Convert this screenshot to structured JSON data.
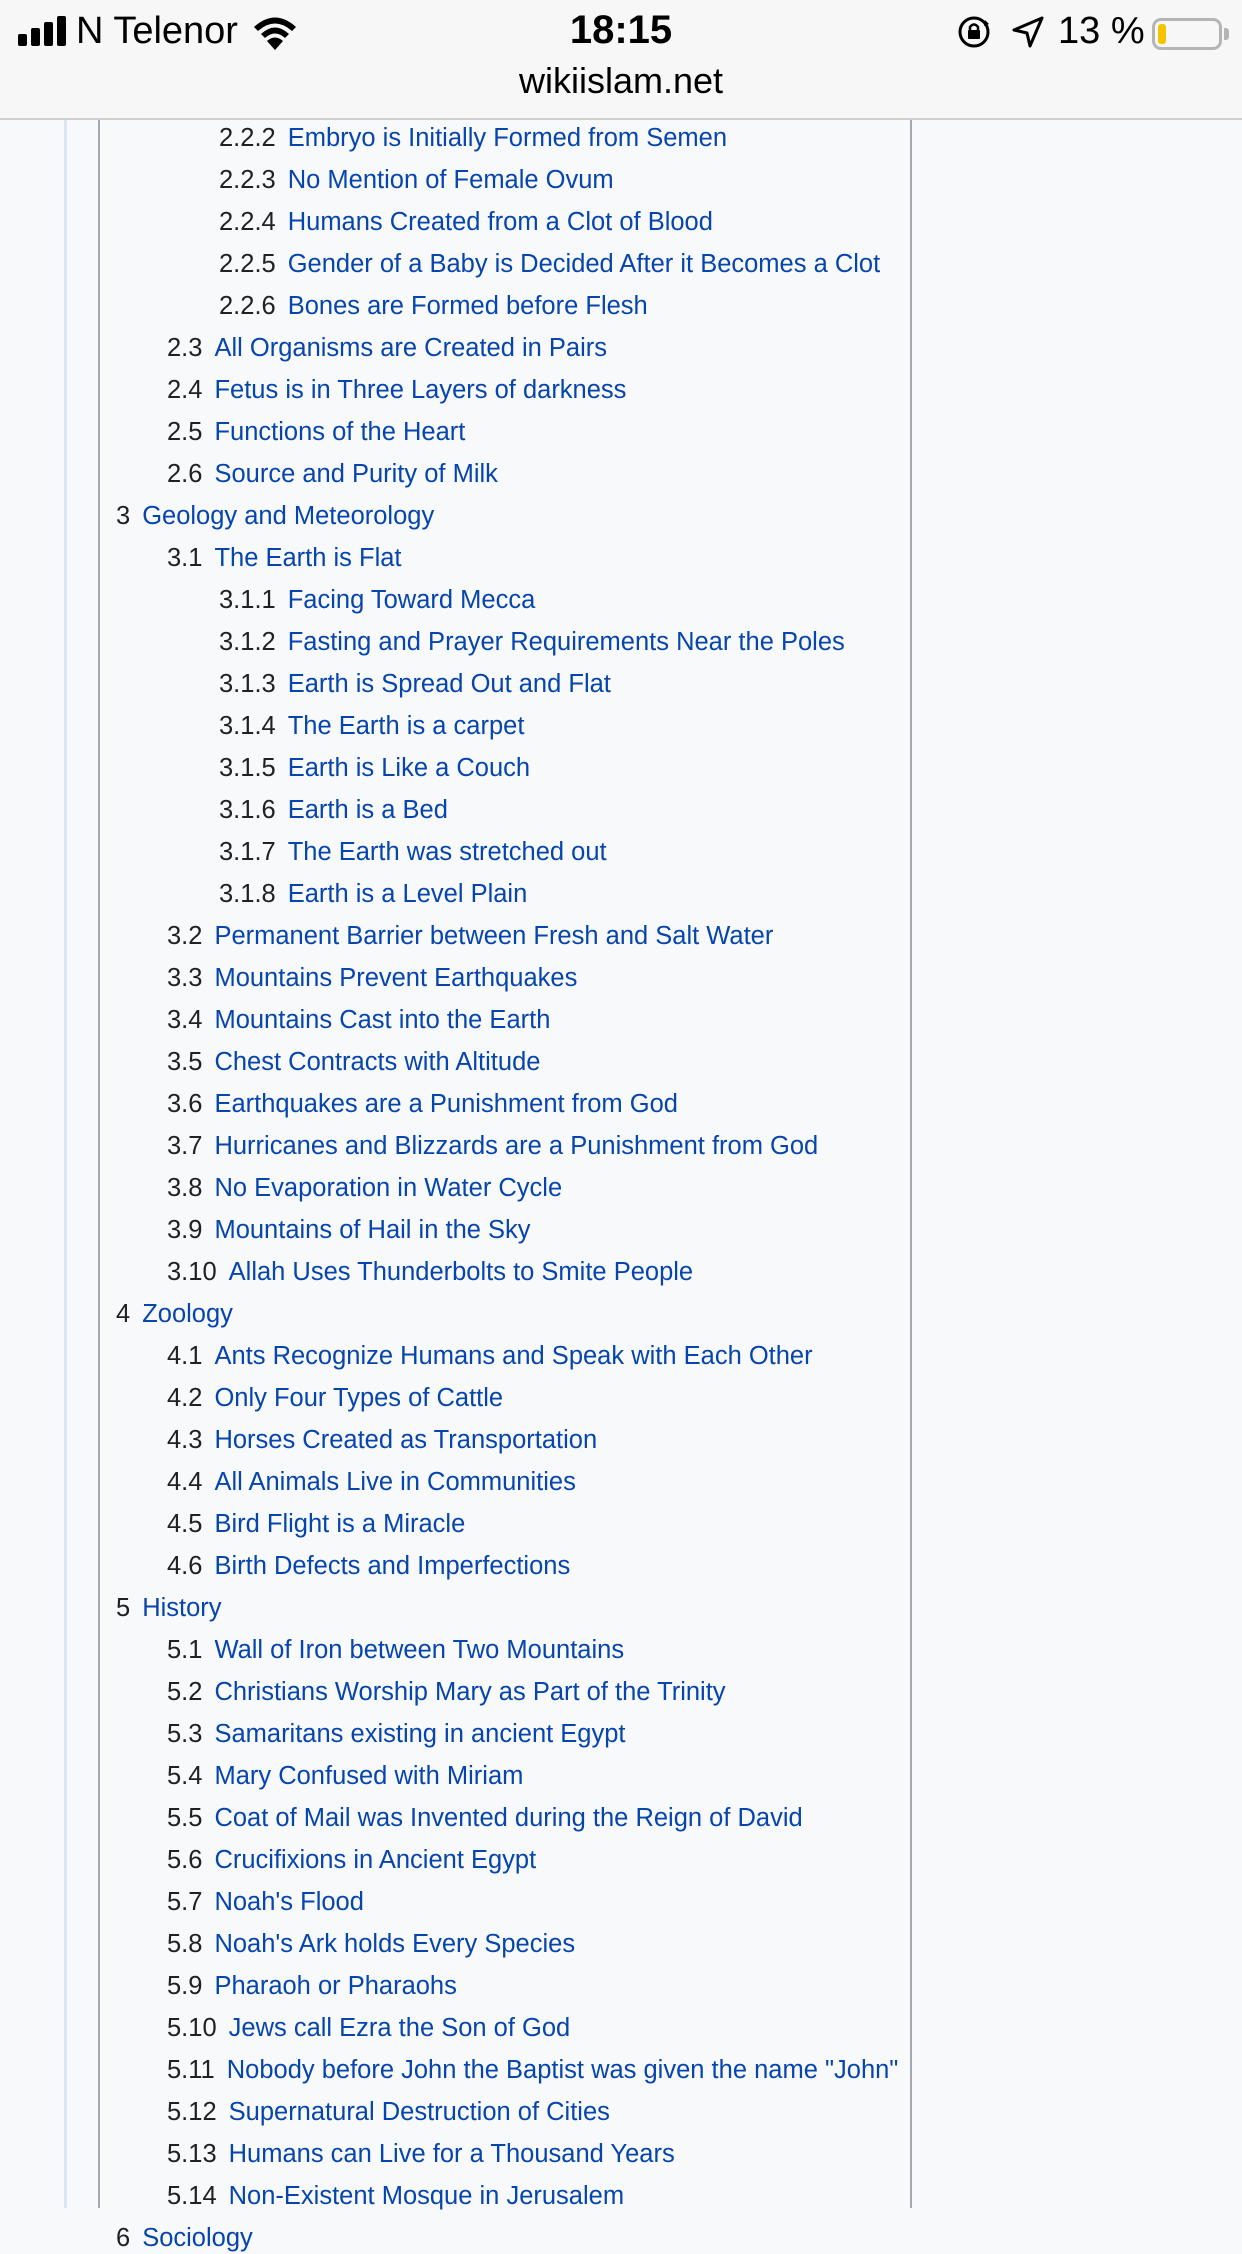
{
  "status_bar": {
    "carrier": "N Telenor",
    "time": "18:15",
    "battery_percent": "13 %",
    "battery_level": 0.13,
    "url": "wikiislam.net"
  },
  "toc": [
    {
      "num": "2.2.2",
      "text": "Embryo is Initially Formed from Semen",
      "level": 3
    },
    {
      "num": "2.2.3",
      "text": "No Mention of Female Ovum",
      "level": 3
    },
    {
      "num": "2.2.4",
      "text": "Humans Created from a Clot of Blood",
      "level": 3
    },
    {
      "num": "2.2.5",
      "text": "Gender of a Baby is Decided After it Becomes a Clot",
      "level": 3
    },
    {
      "num": "2.2.6",
      "text": "Bones are Formed before Flesh",
      "level": 3
    },
    {
      "num": "2.3",
      "text": "All Organisms are Created in Pairs",
      "level": 2
    },
    {
      "num": "2.4",
      "text": "Fetus is in Three Layers of darkness",
      "level": 2
    },
    {
      "num": "2.5",
      "text": "Functions of the Heart",
      "level": 2
    },
    {
      "num": "2.6",
      "text": "Source and Purity of Milk",
      "level": 2
    },
    {
      "num": "3",
      "text": "Geology and Meteorology",
      "level": 1
    },
    {
      "num": "3.1",
      "text": "The Earth is Flat",
      "level": 2
    },
    {
      "num": "3.1.1",
      "text": "Facing Toward Mecca",
      "level": 3
    },
    {
      "num": "3.1.2",
      "text": "Fasting and Prayer Requirements Near the Poles",
      "level": 3
    },
    {
      "num": "3.1.3",
      "text": "Earth is Spread Out and Flat",
      "level": 3
    },
    {
      "num": "3.1.4",
      "text": "The Earth is a carpet",
      "level": 3
    },
    {
      "num": "3.1.5",
      "text": "Earth is Like a Couch",
      "level": 3
    },
    {
      "num": "3.1.6",
      "text": "Earth is a Bed",
      "level": 3
    },
    {
      "num": "3.1.7",
      "text": "The Earth was stretched out",
      "level": 3
    },
    {
      "num": "3.1.8",
      "text": "Earth is a Level Plain",
      "level": 3
    },
    {
      "num": "3.2",
      "text": "Permanent Barrier between Fresh and Salt Water",
      "level": 2
    },
    {
      "num": "3.3",
      "text": "Mountains Prevent Earthquakes",
      "level": 2
    },
    {
      "num": "3.4",
      "text": "Mountains Cast into the Earth",
      "level": 2
    },
    {
      "num": "3.5",
      "text": "Chest Contracts with Altitude",
      "level": 2
    },
    {
      "num": "3.6",
      "text": "Earthquakes are a Punishment from God",
      "level": 2
    },
    {
      "num": "3.7",
      "text": "Hurricanes and Blizzards are a Punishment from God",
      "level": 2
    },
    {
      "num": "3.8",
      "text": "No Evaporation in Water Cycle",
      "level": 2
    },
    {
      "num": "3.9",
      "text": "Mountains of Hail in the Sky",
      "level": 2
    },
    {
      "num": "3.10",
      "text": "Allah Uses Thunderbolts to Smite People",
      "level": 2
    },
    {
      "num": "4",
      "text": "Zoology",
      "level": 1
    },
    {
      "num": "4.1",
      "text": "Ants Recognize Humans and Speak with Each Other",
      "level": 2
    },
    {
      "num": "4.2",
      "text": "Only Four Types of Cattle",
      "level": 2
    },
    {
      "num": "4.3",
      "text": "Horses Created as Transportation",
      "level": 2
    },
    {
      "num": "4.4",
      "text": "All Animals Live in Communities",
      "level": 2
    },
    {
      "num": "4.5",
      "text": "Bird Flight is a Miracle",
      "level": 2
    },
    {
      "num": "4.6",
      "text": "Birth Defects and Imperfections",
      "level": 2
    },
    {
      "num": "5",
      "text": "History",
      "level": 1
    },
    {
      "num": "5.1",
      "text": "Wall of Iron between Two Mountains",
      "level": 2
    },
    {
      "num": "5.2",
      "text": "Christians Worship Mary as Part of the Trinity",
      "level": 2
    },
    {
      "num": "5.3",
      "text": "Samaritans existing in ancient Egypt",
      "level": 2
    },
    {
      "num": "5.4",
      "text": "Mary Confused with Miriam",
      "level": 2
    },
    {
      "num": "5.5",
      "text": "Coat of Mail was Invented during the Reign of David",
      "level": 2
    },
    {
      "num": "5.6",
      "text": "Crucifixions in Ancient Egypt",
      "level": 2
    },
    {
      "num": "5.7",
      "text": "Noah's Flood",
      "level": 2
    },
    {
      "num": "5.8",
      "text": "Noah's Ark holds Every Species",
      "level": 2
    },
    {
      "num": "5.9",
      "text": "Pharaoh or Pharaohs",
      "level": 2
    },
    {
      "num": "5.10",
      "text": "Jews call Ezra the Son of God",
      "level": 2
    },
    {
      "num": "5.11",
      "text": "Nobody before John the Baptist was given the name \"John\"",
      "level": 2
    },
    {
      "num": "5.12",
      "text": "Supernatural Destruction of Cities",
      "level": 2
    },
    {
      "num": "5.13",
      "text": "Humans can Live for a Thousand Years",
      "level": 2
    },
    {
      "num": "5.14",
      "text": "Non-Existent Mosque in Jerusalem",
      "level": 2
    },
    {
      "num": "6",
      "text": "Sociology",
      "level": 1
    }
  ]
}
